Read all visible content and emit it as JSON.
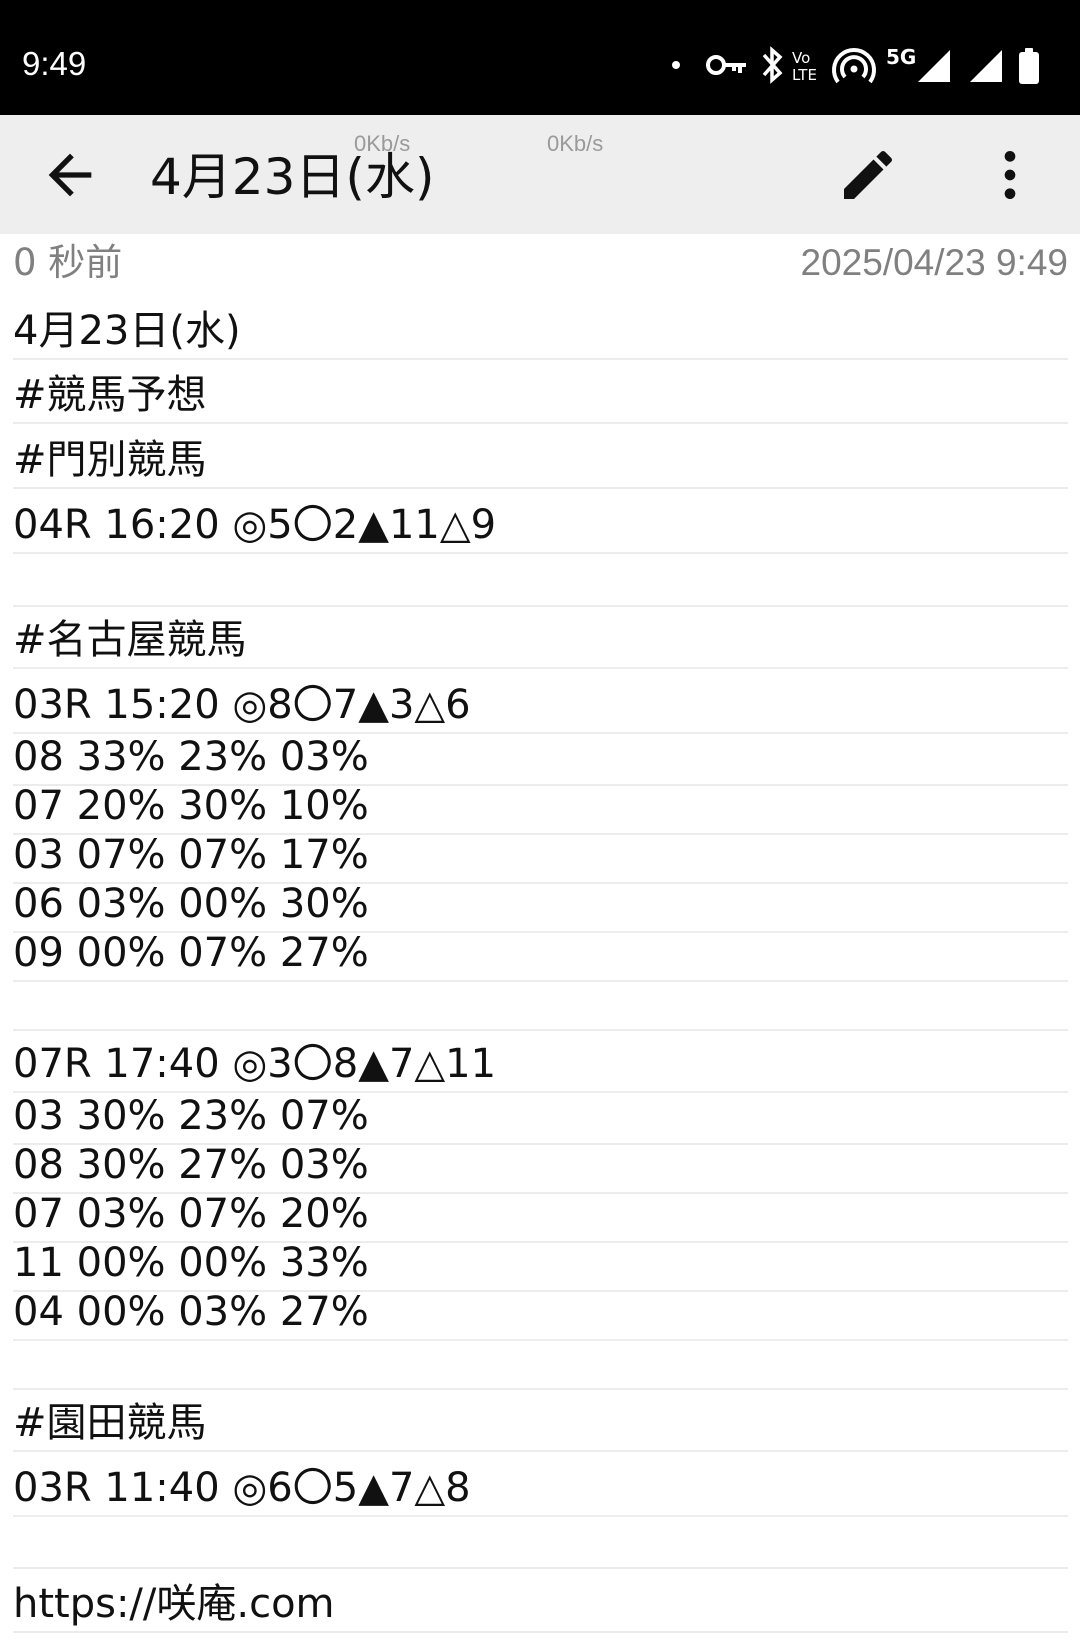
{
  "status_bar": {
    "time": "9:49",
    "icons": [
      "dot-icon",
      "vpn-key-icon",
      "bluetooth-icon",
      "volte-icon",
      "hotspot-icon",
      "5g-icon",
      "signal-icon",
      "signal-icon",
      "battery-icon"
    ],
    "network_label": "5G",
    "volte_label_top": "Vo",
    "volte_label_bottom": "LTE"
  },
  "app_bar": {
    "title": "4月23日(水)",
    "net_speed_1": "0Kb/s",
    "net_speed_2": "0Kb/s",
    "icons": [
      "arrow-back-icon",
      "edit-pencil-icon",
      "more-vert-icon"
    ]
  },
  "meta": {
    "relative_time": "0 秒前",
    "timestamp": "2025/04/23 9:49"
  },
  "note": {
    "lines": [
      "4月23日(水)",
      "#競馬予想",
      "#門別競馬",
      "04R 16:20 ◎5〇2▲11△9",
      "",
      "#名古屋競馬",
      "03R 15:20 ◎8〇7▲3△6",
      "08 33% 23% 03%",
      "07 20% 30% 10%",
      "03 07% 07% 17%",
      "06 03% 00% 30%",
      "09 00% 07% 27%",
      "",
      "07R 17:40 ◎3〇8▲7△11",
      "03 30% 23% 07%",
      "08 30% 27% 03%",
      "07 03% 07% 20%",
      "11 00% 00% 33%",
      "04 00% 03% 27%",
      "",
      "#園田競馬",
      "03R 11:40 ◎6〇5▲7△8",
      "",
      "https://咲庵.com"
    ]
  },
  "colors": {
    "status_bar_bg": "#000000",
    "app_bar_bg": "#eeeeee",
    "meta_text": "#808080",
    "rule_line": "#ececec"
  }
}
